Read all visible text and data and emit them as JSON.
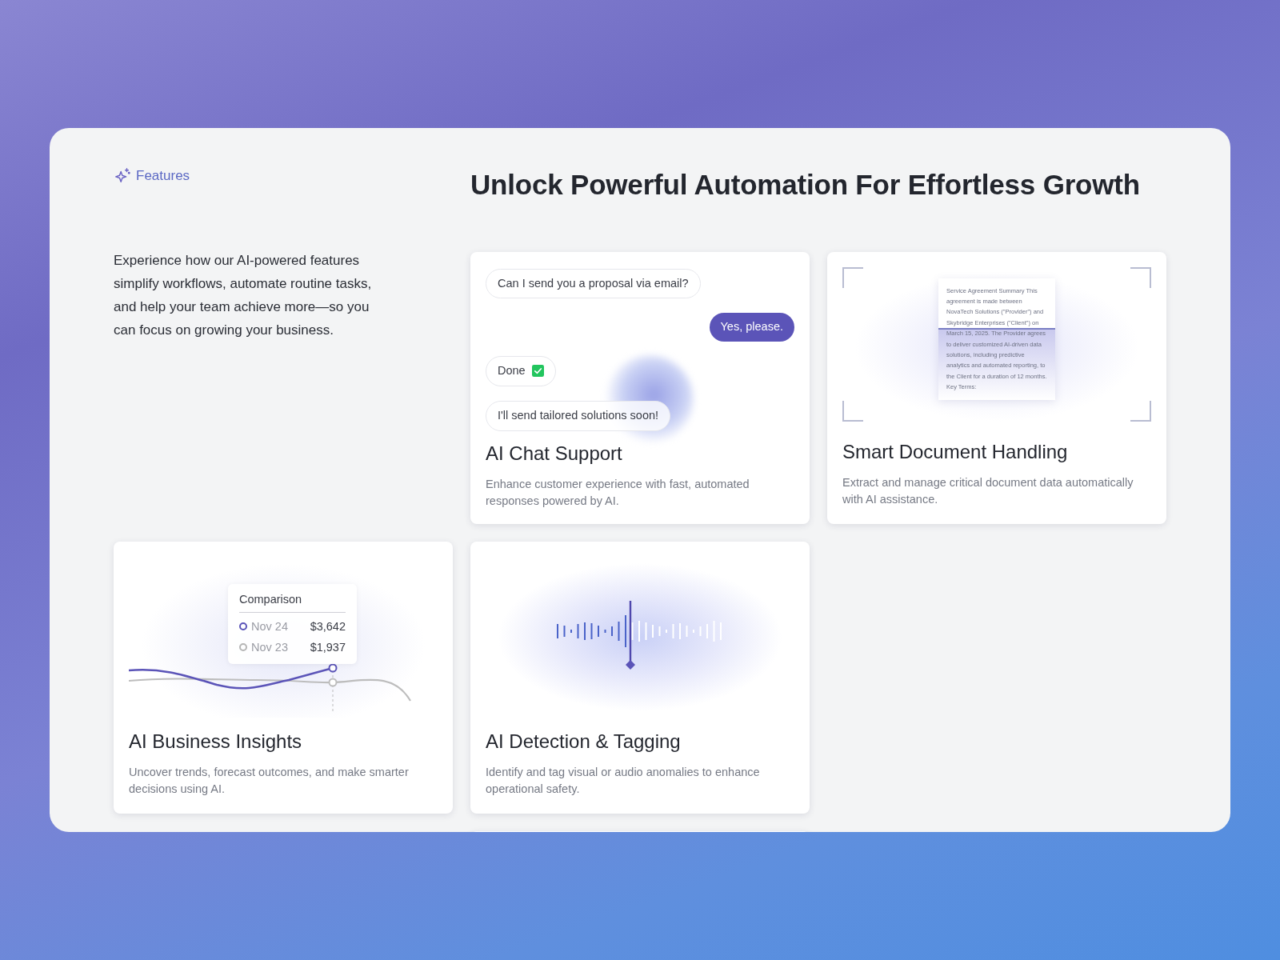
{
  "badge": {
    "label": "Features"
  },
  "heading": "Unlock Powerful Automation For Effortless Growth",
  "intro": "Experience how our AI-powered features simplify workflows, automate routine tasks, and help your team achieve more—so you can focus on growing your business.",
  "cards": [
    {
      "kind": "chat",
      "title": "AI Chat Support",
      "description": "Enhance customer experience with fast, automated responses powered by AI.",
      "messages": [
        {
          "text": "Can I send you a proposal via email?",
          "kind": "incoming",
          "checked": false
        },
        {
          "text": "Yes, please.",
          "kind": "outgoing",
          "checked": false
        },
        {
          "text": "Done",
          "kind": "incoming",
          "checked": true
        },
        {
          "text": "I'll send tailored solutions soon!",
          "kind": "incoming",
          "checked": false
        }
      ]
    },
    {
      "kind": "document",
      "title": "Smart Document Handling",
      "description": "Extract and manage critical document data automatically with AI assistance.",
      "document_text": "Service Agreement Summary  This agreement is made between NovaTech Solutions (\"Provider\") and Skybridge Enterprises (\"Client\") on March 15, 2025. The Provider agrees to deliver customized AI-driven data solutions, including predictive analytics and automated reporting, to the Client for a duration of 12 months.  Key Terms:"
    },
    {
      "kind": "insights",
      "title": "AI Business Insights",
      "description": "Uncover trends, forecast outcomes, and make smarter decisions using AI.",
      "tooltip": {
        "title": "Comparison",
        "rows": [
          {
            "label": "Nov 24",
            "value": "$3,642",
            "color": "#5b54b8"
          },
          {
            "label": "Nov 23",
            "value": "$1,937",
            "color": "#b5b5b5"
          }
        ]
      }
    },
    {
      "kind": "waveform",
      "title": "AI Detection & Tagging",
      "description": "Identify and tag visual or audio anomalies to enhance operational safety."
    }
  ]
}
